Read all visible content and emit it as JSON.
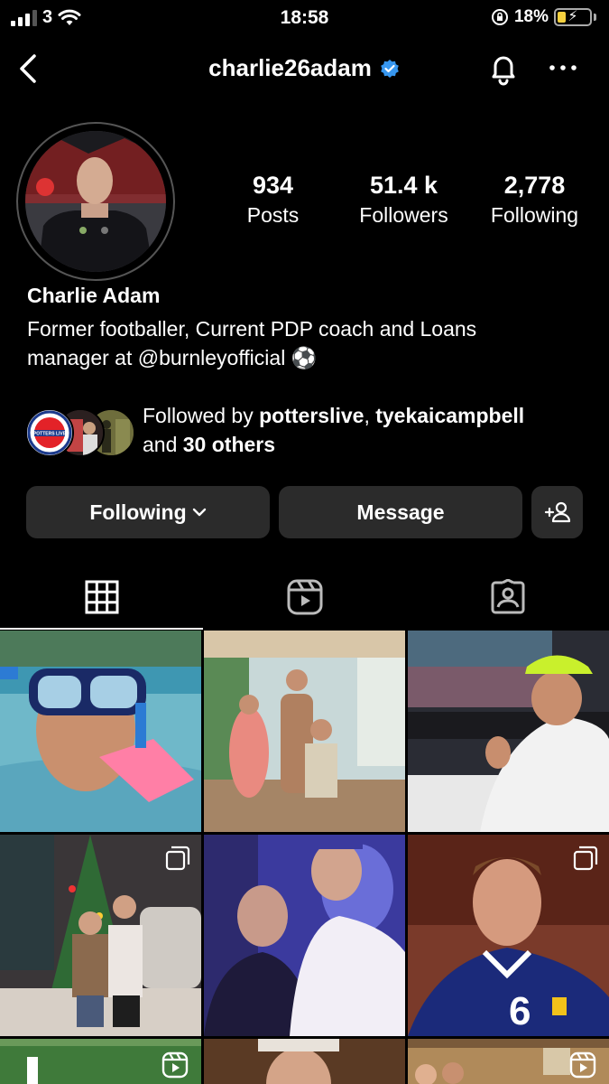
{
  "status_bar": {
    "carrier": "3",
    "time": "18:58",
    "battery_percent": "18%"
  },
  "nav": {
    "username": "charlie26adam"
  },
  "profile": {
    "name": "Charlie Adam",
    "bio_line1": "Former footballer, Current PDP coach and Loans",
    "bio_line2": "manager at @burnleyofficial ⚽"
  },
  "stats": {
    "posts_value": "934",
    "posts_label": "Posts",
    "followers_value": "51.4 k",
    "followers_label": "Followers",
    "following_value": "2,778",
    "following_label": "Following"
  },
  "followed_by": {
    "prefix": "Followed by ",
    "user1": "potterslive",
    "separator": ", ",
    "user2": "tyekaicampbell",
    "and": "and ",
    "others": "30 others",
    "mini_avatar_text": "POTTERS LIVE"
  },
  "buttons": {
    "following_label": "Following",
    "message_label": "Message"
  },
  "tabs": [
    "grid",
    "reels",
    "tagged"
  ],
  "colors": {
    "background": "#000000",
    "button_bg": "#2b2b2b",
    "verified_blue": "#3797f0",
    "battery_yellow": "#f4d03f"
  },
  "grid": {
    "tiles": [
      {
        "badge": "none"
      },
      {
        "badge": "none"
      },
      {
        "badge": "none"
      },
      {
        "badge": "multiple"
      },
      {
        "badge": "none"
      },
      {
        "badge": "multiple"
      },
      {
        "badge": "reel"
      },
      {
        "badge": "none"
      },
      {
        "badge": "reel"
      }
    ]
  }
}
